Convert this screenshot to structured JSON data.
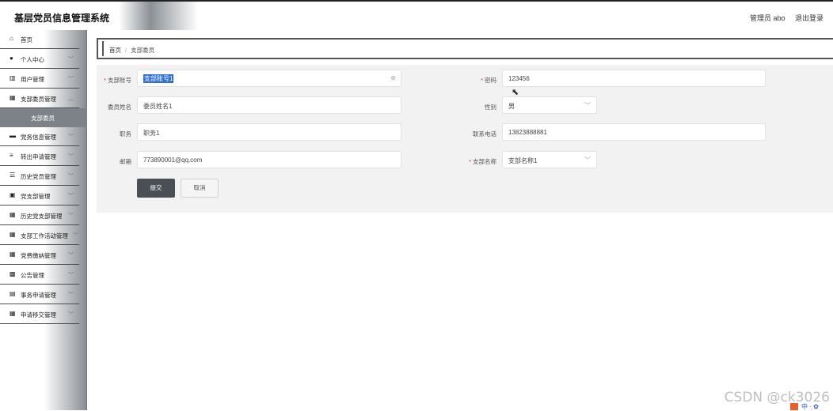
{
  "header": {
    "app_title": "基层党员信息管理系统",
    "user_label": "管理员 abo",
    "logout_label": "退出登录"
  },
  "sidebar": {
    "items": [
      {
        "label": "首页",
        "icon": "home-icon",
        "glyph": "⌂",
        "chevron": false
      },
      {
        "label": "个人中心",
        "icon": "user-icon",
        "glyph": "●",
        "chevron": true
      },
      {
        "label": "用户管理",
        "icon": "bar-chart-icon",
        "glyph": "▥",
        "chevron": true
      },
      {
        "label": "支部委员管理",
        "icon": "grid-icon",
        "glyph": "▦",
        "chevron": true,
        "expanded": true
      },
      {
        "label": "党务信息管理",
        "icon": "folder-icon",
        "glyph": "▬",
        "chevron": true
      },
      {
        "label": "转出申请管理",
        "icon": "sliders-icon",
        "glyph": "≡",
        "chevron": true
      },
      {
        "label": "历史党员管理",
        "icon": "list-icon",
        "glyph": "☰",
        "chevron": true
      },
      {
        "label": "党支部管理",
        "icon": "image-icon",
        "glyph": "▣",
        "chevron": true
      },
      {
        "label": "历史党支部管理",
        "icon": "grid-icon",
        "glyph": "▦",
        "chevron": true
      },
      {
        "label": "支部工作活动管理",
        "icon": "grid-icon",
        "glyph": "▦",
        "chevron": true
      },
      {
        "label": "党费缴纳管理",
        "icon": "grid-icon",
        "glyph": "▦",
        "chevron": true
      },
      {
        "label": "公告管理",
        "icon": "film-icon",
        "glyph": "▩",
        "chevron": true
      },
      {
        "label": "事务申请管理",
        "icon": "printer-icon",
        "glyph": "▤",
        "chevron": true
      },
      {
        "label": "申请移交管理",
        "icon": "grid-icon",
        "glyph": "▦",
        "chevron": true
      }
    ],
    "sub_item": "支部委员"
  },
  "breadcrumb": {
    "home": "首页",
    "separator": "/",
    "current": "支部委员"
  },
  "form": {
    "account": {
      "label": "支部账号",
      "required": true,
      "value": "支部账号1"
    },
    "password": {
      "label": "密码",
      "required": true,
      "value": "123456"
    },
    "name": {
      "label": "委员姓名",
      "required": false,
      "value": "委员姓名1"
    },
    "gender": {
      "label": "性别",
      "required": false,
      "value": "男"
    },
    "position": {
      "label": "职务",
      "required": false,
      "value": "职务1"
    },
    "phone": {
      "label": "联系电话",
      "required": false,
      "value": "13823888881"
    },
    "email": {
      "label": "邮箱",
      "required": false,
      "value": "773890001@qq.com"
    },
    "branch": {
      "label": "支部名称",
      "required": true,
      "value": "支部名称1"
    }
  },
  "buttons": {
    "submit": "提交",
    "cancel": "取消"
  },
  "watermark": "CSDN @ck3026",
  "tray_text": "中 ·̩ ✿",
  "colors": {
    "required": "#ee2244",
    "submit_bg": "#4a4f55",
    "selection": "#2f6fd1"
  }
}
